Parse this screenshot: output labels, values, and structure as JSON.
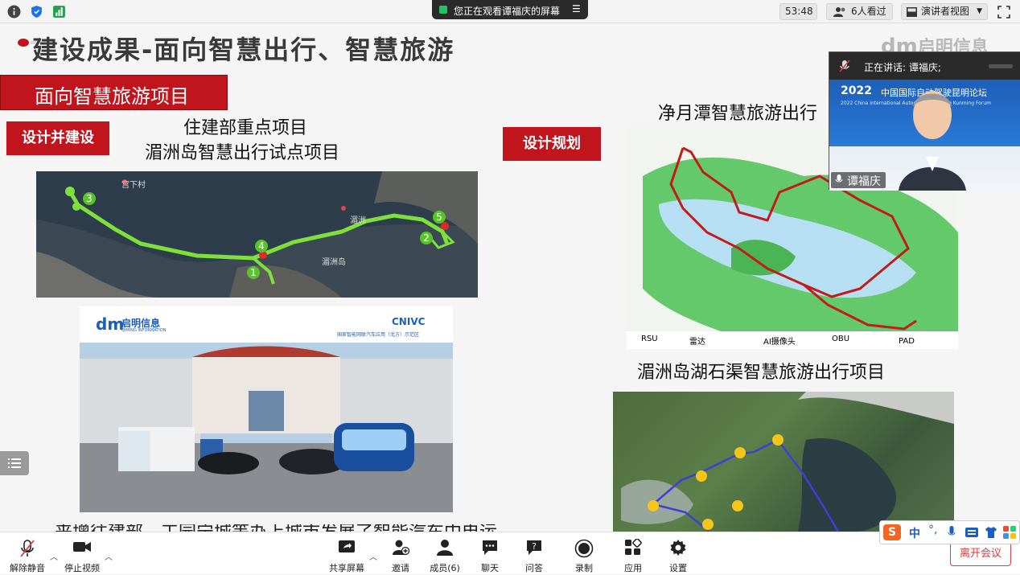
{
  "topbar": {
    "share_banner_text": "您正在观看谭福庆的屏幕",
    "timer": "53:48",
    "viewers": "6人看过",
    "view_mode": "演讲者视图"
  },
  "slide": {
    "title": "建设成果-面向智慧出行、智慧旅游",
    "brand_logo": "启明信息",
    "section_banner": "面向智慧旅游项目",
    "badge_build": "设计并建设",
    "badge_plan": "设计规划",
    "left_heading_line1": "住建部重点项目",
    "left_heading_line2": "湄洲岛智慧出行试点项目",
    "right_heading_top": "净月潭智慧旅游出行",
    "right_heading_bottom": "湄洲岛湖石渠智慧旅游出行项目",
    "bottom_text_partial": "来增往建部、工园宁城等办上城市发展了智能汽车中电运",
    "map_island": {
      "route_markers": [
        "1",
        "2",
        "3",
        "4",
        "5"
      ],
      "labels": [
        "宫下村",
        "湄洲",
        "湄洲岛"
      ]
    },
    "photo_cars": {
      "logo_text": "启明信息",
      "logo_subtext": "QIMING INFORMATION",
      "cnivc_label": "CNIVC",
      "cnivc_subtext": "国家智能网联汽车应用（北方）示范区"
    },
    "map_lake": {
      "legend": [
        "RSU",
        "雷达",
        "AI摄像头",
        "OBU",
        "PAD"
      ]
    }
  },
  "speaker": {
    "header_text": "正在讲话: 谭福庆;",
    "name": "谭福庆",
    "forum_year": "2022",
    "forum_title": "中国国际自动驾驶昆明论坛",
    "forum_subtitle": "2022 China International Autonomous Driving Kunming Forum"
  },
  "toolbar": {
    "unmute": "解除静音",
    "stop_video": "停止视频",
    "share_screen": "共享屏幕",
    "invite": "邀请",
    "members": "成员(6)",
    "chat": "聊天",
    "qa": "问答",
    "record": "录制",
    "apps": "应用",
    "settings": "设置",
    "leave": "离开会议"
  },
  "ime": {
    "lang": "中"
  },
  "colors": {
    "accent_red": "#c0151c",
    "route_green": "#7ee03a",
    "route_red": "#c21b1b",
    "leave_red": "#e23b3b"
  }
}
